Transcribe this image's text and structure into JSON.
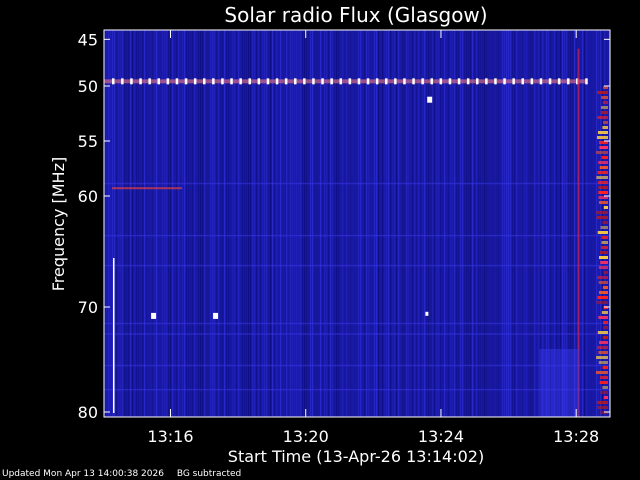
{
  "chart_data": {
    "type": "heatmap",
    "title": "Solar radio Flux (Glasgow)",
    "xlabel": "Start Time (13-Apr-26 13:14:02)",
    "ylabel": "Frequency [MHz]",
    "x_ticks": [
      "13:16",
      "13:20",
      "13:24",
      "13:28"
    ],
    "y_ticks": [
      "45",
      "50",
      "55",
      "60",
      "70",
      "80"
    ],
    "x_range": [
      "13:14:02",
      "13:29:00"
    ],
    "y_range_mhz": [
      44,
      80
    ],
    "colormap": [
      "#0000a0",
      "#2a2af0",
      "#ff2020",
      "#ffd040",
      "#ffffff"
    ],
    "features": {
      "interference_line_mhz": 49.5,
      "intense_emission_start": "13:28:20"
    }
  },
  "footer": {
    "updated": "Updated Mon Apr 13 14:00:38 2026",
    "note": "BG subtracted"
  },
  "colors": {
    "background": "#000000",
    "spectrogram_base": "#1a1aa0",
    "text": "#ffffff"
  }
}
